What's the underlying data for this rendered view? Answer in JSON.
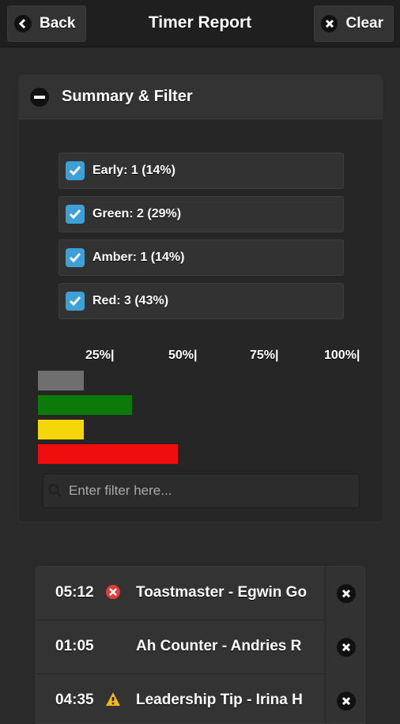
{
  "header": {
    "title": "Timer Report",
    "back_label": "Back",
    "clear_label": "Clear"
  },
  "summary": {
    "title": "Summary & Filter",
    "filters": [
      {
        "label": "Early: 1 (14%)",
        "checked": true
      },
      {
        "label": "Green: 2 (29%)",
        "checked": true
      },
      {
        "label": "Amber: 1 (14%)",
        "checked": true
      },
      {
        "label": "Red: 3 (43%)",
        "checked": true
      }
    ],
    "filter_placeholder": "Enter filter here..."
  },
  "chart_data": {
    "type": "bar",
    "orientation": "horizontal",
    "categories": [
      "Early",
      "Green",
      "Amber",
      "Red"
    ],
    "values": [
      14,
      29,
      14,
      43
    ],
    "colors": [
      "#6f6f6f",
      "#0b7a0b",
      "#f5d60a",
      "#f00d0d"
    ],
    "tick_labels": [
      "25%|",
      "50%|",
      "75%|",
      "100%|"
    ],
    "xlim": [
      0,
      100
    ]
  },
  "entries": [
    {
      "time": "05:12",
      "status": "red",
      "name": "Toastmaster - Egwin Go"
    },
    {
      "time": "01:05",
      "status": "none",
      "name": "Ah Counter - Andries R"
    },
    {
      "time": "04:35",
      "status": "amber",
      "name": "Leadership Tip - Irina H"
    }
  ]
}
